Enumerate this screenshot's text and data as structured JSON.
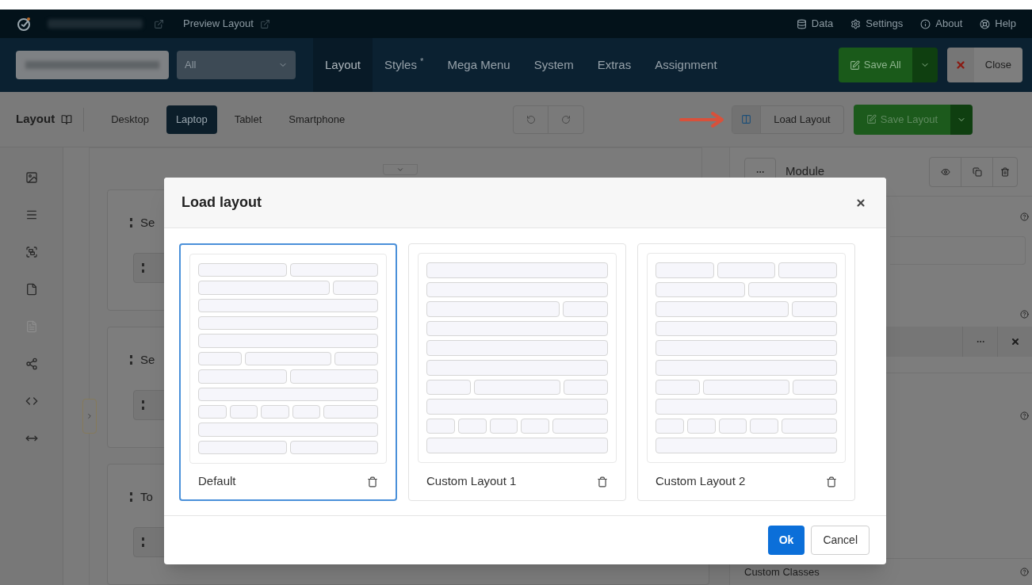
{
  "top_bar": {
    "preview_link": "Preview Layout",
    "menu": [
      {
        "label": "Data",
        "kind": "data"
      },
      {
        "label": "Settings",
        "kind": "settings"
      },
      {
        "label": "About",
        "kind": "about"
      },
      {
        "label": "Help",
        "kind": "help"
      }
    ]
  },
  "nav_bar": {
    "filter": {
      "value": "All"
    },
    "tabs": [
      {
        "label": "Layout",
        "selected": true
      },
      {
        "label": "Styles $^{*}$",
        "selected": false
      },
      {
        "label": "Mega Menu",
        "selected": false
      },
      {
        "label": "System",
        "selected": false
      },
      {
        "label": "Extras",
        "selected": false
      },
      {
        "label": "Assignment",
        "selected": false
      }
    ],
    "save_all": "Save All",
    "close": "Close"
  },
  "toolbar": {
    "title": "Layout",
    "devices": [
      {
        "label": "Desktop",
        "selected": false
      },
      {
        "label": "Laptop",
        "selected": true
      },
      {
        "label": "Tablet",
        "selected": false
      },
      {
        "label": "Smartphone",
        "selected": false
      }
    ],
    "load_layout": "Load Layout",
    "save_layout": {
      "label": "Save Layout",
      "disabled": true
    }
  },
  "canvas": {
    "sections": [
      {
        "title": "Se"
      },
      {
        "title": "Se"
      },
      {
        "title": "To"
      }
    ]
  },
  "module_panel": {
    "title": "Module",
    "field_label": "Custom Classes"
  },
  "dialog": {
    "title": "Load layout",
    "layouts": [
      {
        "name": "Default",
        "selected": true
      },
      {
        "name": "Custom Layout 1",
        "selected": false
      },
      {
        "name": "Custom Layout 2",
        "selected": false
      }
    ],
    "ok": "Ok",
    "cancel": "Cancel"
  }
}
